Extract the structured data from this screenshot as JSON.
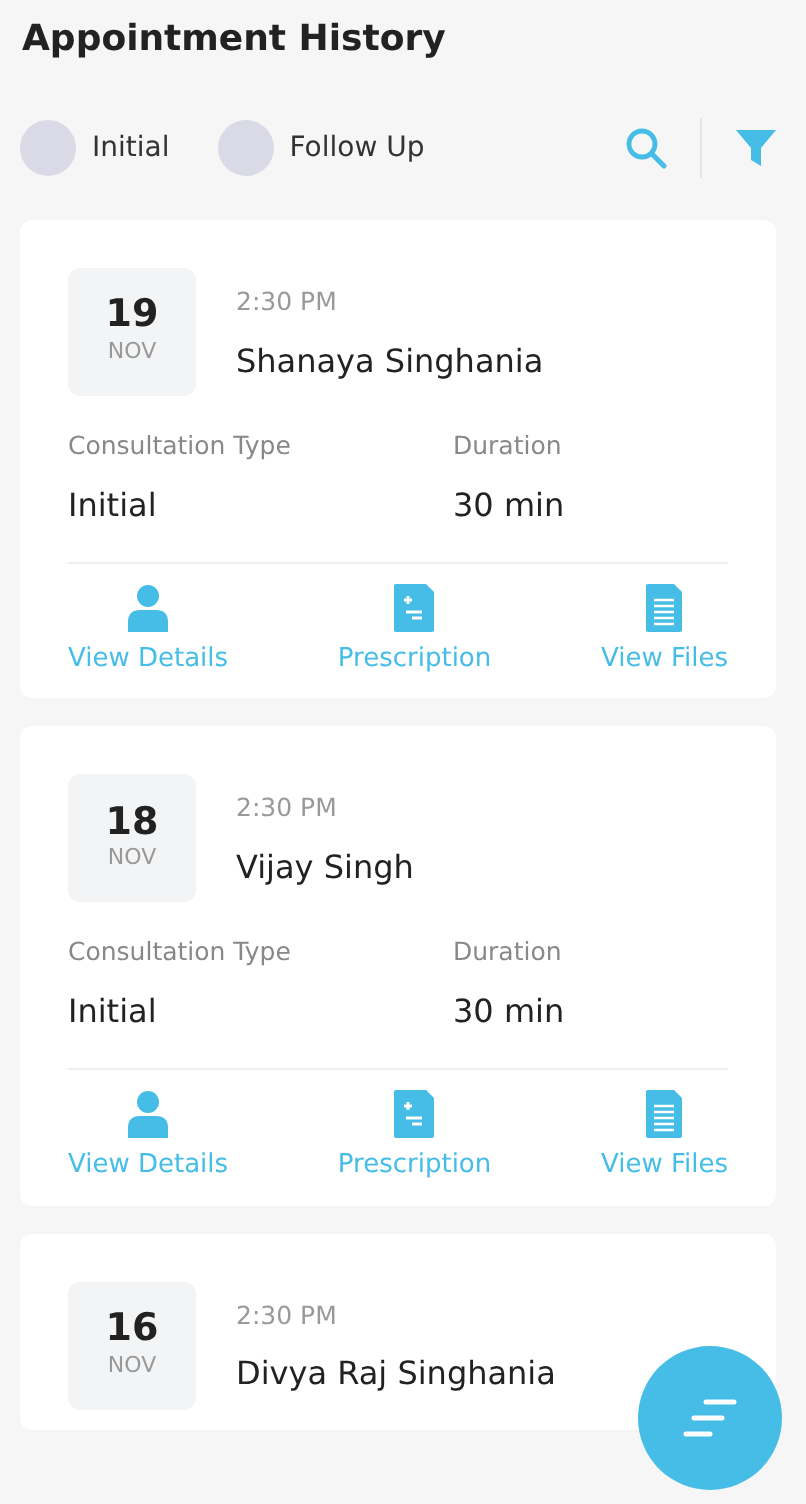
{
  "title": "Appointment History",
  "legend": [
    {
      "label": "Initial"
    },
    {
      "label": "Follow Up"
    }
  ],
  "appointments": [
    {
      "day": "19",
      "month": "NOV",
      "time": "2:30 PM",
      "name": "Shanaya Singhania",
      "type_label": "Consultation Type",
      "type": "Initial",
      "duration_label": "Duration",
      "duration": "30 min",
      "actions": [
        {
          "kind": "person",
          "label": "View Details"
        },
        {
          "kind": "prescription",
          "label": "Prescription"
        },
        {
          "kind": "file",
          "label": "View Files"
        }
      ]
    },
    {
      "day": "18",
      "month": "NOV",
      "time": "2:30 PM",
      "name": "Vijay Singh",
      "type_label": "Consultation Type",
      "type": "Initial",
      "duration_label": "Duration",
      "duration": "30 min",
      "actions": [
        {
          "kind": "person",
          "label": "View Details"
        },
        {
          "kind": "prescription",
          "label": "Prescription"
        },
        {
          "kind": "file",
          "label": "View Files"
        }
      ]
    },
    {
      "day": "16",
      "month": "NOV",
      "time": "2:30 PM",
      "name": "Divya Raj Singhania"
    }
  ]
}
